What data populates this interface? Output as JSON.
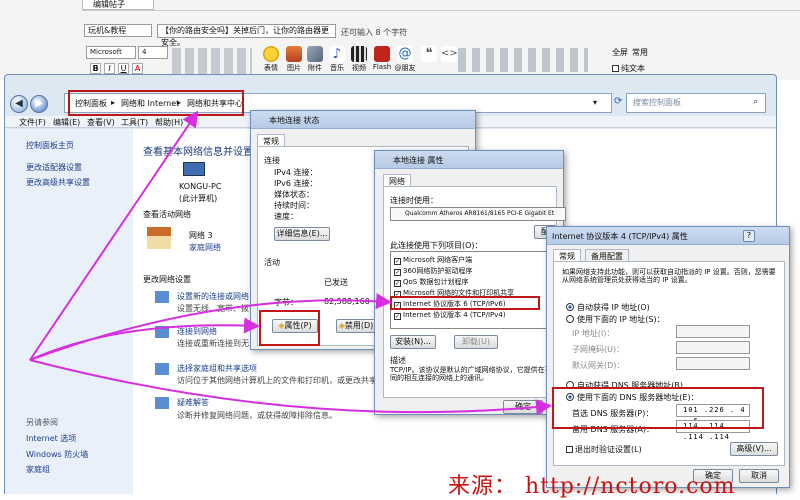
{
  "editor": {
    "tab": "编辑帖子",
    "type_select": "玩机&教程",
    "subject": "【你的路由安全吗】关掉后门，让你的路由器更安全。",
    "subject_hint": "还可输入 8 个字符",
    "font_select": "Microsoft",
    "size_select": "4",
    "fmt_bold": "B",
    "fmt_italic": "I",
    "fmt_underline": "U",
    "fmt_color": "A",
    "tools": [
      "表情",
      "图片",
      "附件",
      "音乐",
      "视频",
      "Flash",
      "@朋友",
      "引用",
      "代码"
    ],
    "fullscreen": "全屏",
    "common": "常用",
    "plaintext": "纯文本"
  },
  "window": {
    "breadcrumb": [
      "控制面板",
      "网络和 Internet",
      "网络和共享中心"
    ],
    "search_placeholder": "搜索控制面板",
    "menu": [
      "文件(F)",
      "编辑(E)",
      "查看(V)",
      "工具(T)",
      "帮助(H)"
    ],
    "left_links": [
      "控制面板主页",
      "更改适配器设置",
      "更改高级共享设置"
    ],
    "see_also_title": "另请参阅",
    "see_also": [
      "Internet 选项",
      "Windows 防火墙",
      "家庭组"
    ],
    "center_title": "查看基本网络信息并设置",
    "pc_name": "KONGU-PC",
    "pc_sub": "(此计算机)",
    "active_networks": "查看活动网络",
    "network_name": "网络 3",
    "network_type": "家庭网络",
    "change_settings": "更改网络设置",
    "tasks": [
      {
        "title": "设置新的连接或网络",
        "desc": "设置无线、宽带、拨号"
      },
      {
        "title": "连接到网络",
        "desc": "连接或重新连接到无"
      },
      {
        "title": "选择家庭组和共享选项",
        "desc": "访问位于其他网络计算机上的文件和打印机，或更改共享设置。"
      },
      {
        "title": "疑难解答",
        "desc": "诊断并修复网络问题，或获得故障排除信息。"
      }
    ]
  },
  "status_dialog": {
    "title": "本地连接 状态",
    "tab": "常规",
    "connection_heading": "连接",
    "rows": [
      "IPv4 连接：",
      "IPv6 连接：",
      "媒体状态：",
      "持续时间：",
      "速度："
    ],
    "details_button": "详细信息(E)...",
    "activity_heading": "活动",
    "sent_label": "已发送",
    "bytes_label": "字节：",
    "bytes_value": "82,588,160",
    "properties_button": "属性(P)",
    "disable_button": "禁用(D)"
  },
  "props_dialog": {
    "title": "本地连接 属性",
    "tab": "网络",
    "connect_using_label": "连接时使用：",
    "adapter": "Qualcomm Atheros AR8161/8165 PCI-E Gigabit Et",
    "configure_button": "配",
    "items_label": "此连接使用下列项目(O)：",
    "items": [
      "Microsoft 网络客户端",
      "360网络防护驱动程序",
      "QoS 数据包计划程序",
      "Microsoft 网络的文件和打印机共享",
      "Internet 协议版本 6 (TCP/IPv6)",
      "Internet 协议版本 4 (TCP/IPv4)"
    ],
    "install_button": "安装(N)...",
    "uninstall_button": "卸载(U)",
    "description_heading": "描述",
    "description": "TCP/IP。该协议是默认的广域网络协议，它提供在不同的相互连接的网络上的通讯。",
    "ok_button": "确定"
  },
  "ipv4_dialog": {
    "title": "Internet 协议版本 4 (TCP/IPv4) 属性",
    "help": "?",
    "tabs": [
      "常规",
      "备用配置"
    ],
    "intro": "如果网络支持此功能，则可以获取自动指派的 IP 设置。否则，您需要从网络系统管理员处获得适当的 IP 设置。",
    "auto_ip": "自动获得 IP 地址(O)",
    "manual_ip": "使用下面的 IP 地址(S)：",
    "ip_label": "IP 地址(I)：",
    "mask_label": "子网掩码(U)：",
    "gateway_label": "默认网关(D)：",
    "auto_dns": "自动获得 DNS 服务器地址(B)",
    "manual_dns": "使用下面的 DNS 服务器地址(E)：",
    "preferred_dns_label": "首选 DNS 服务器(P)：",
    "preferred_dns": "101 .226 . 4 . 6",
    "alternate_dns_label": "备用 DNS 服务器(A)：",
    "alternate_dns": "114 .114 .114 .114",
    "validate_on_exit": "退出时验证设置(L)",
    "advanced_button": "高级(V)...",
    "ok_button": "确定",
    "cancel_button": "取消"
  },
  "watermark": "来源： http://nctoro.com",
  "colors": {
    "annotation_arrow": "#d62ee0",
    "highlight_box": "#c0181a",
    "watermark": "#cc1111"
  }
}
